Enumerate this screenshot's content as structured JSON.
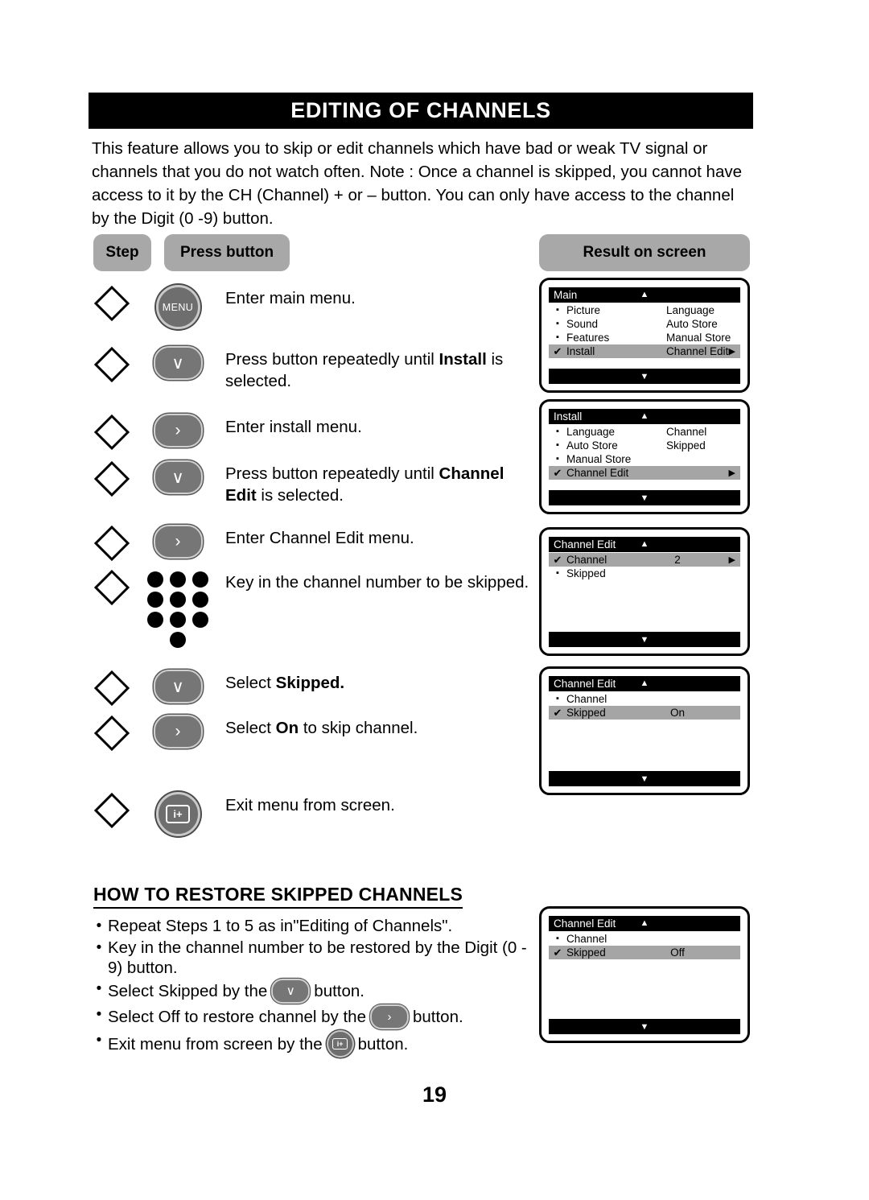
{
  "page": {
    "title": "EDITING OF CHANNELS",
    "intro": "This feature allows you to skip or edit channels which have bad or weak TV signal or channels that you do not watch often. Note : Once a channel is skipped, you cannot have access to it by the CH (Channel) + or – button. You can only have access to the channel by the Digit (0 -9) button.",
    "page_number": "19"
  },
  "table_headers": {
    "step": "Step",
    "press_button": "Press button",
    "result_on_screen": "Result on screen"
  },
  "steps": [
    {
      "button": "MENU",
      "button_type": "round-text",
      "text_parts": [
        {
          "t": "Enter main menu.",
          "bold": false
        }
      ]
    },
    {
      "button": "∨",
      "button_type": "oval",
      "text_parts": [
        {
          "t": "Press button repeatedly until ",
          "bold": false
        },
        {
          "t": "Install",
          "bold": true
        },
        {
          "t": " is selected.",
          "bold": false
        }
      ]
    },
    {
      "button": "›",
      "button_type": "oval",
      "text_parts": [
        {
          "t": "Enter install menu.",
          "bold": false
        }
      ]
    },
    {
      "button": "∨",
      "button_type": "oval",
      "text_parts": [
        {
          "t": "Press button repeatedly until ",
          "bold": false
        },
        {
          "t": "Channel Edit",
          "bold": true
        },
        {
          "t": " is selected.",
          "bold": false
        }
      ]
    },
    {
      "button": "›",
      "button_type": "oval",
      "text_parts": [
        {
          "t": "Enter Channel Edit menu.",
          "bold": false
        }
      ]
    },
    {
      "button": "keypad",
      "button_type": "keypad",
      "text_parts": [
        {
          "t": "Key in the channel number to be skipped.",
          "bold": false
        }
      ]
    },
    {
      "button": "∨",
      "button_type": "oval",
      "text_parts": [
        {
          "t": "Select ",
          "bold": false
        },
        {
          "t": "Skipped.",
          "bold": true
        }
      ]
    },
    {
      "button": "›",
      "button_type": "oval",
      "text_parts": [
        {
          "t": "Select ",
          "bold": false
        },
        {
          "t": "On",
          "bold": true
        },
        {
          "t": " to skip channel.",
          "bold": false
        }
      ]
    },
    {
      "button": "i+",
      "button_type": "round-info",
      "text_parts": [
        {
          "t": "Exit menu from screen.",
          "bold": false
        }
      ]
    }
  ],
  "screens": [
    {
      "title": "Main",
      "up_arrow": "▲",
      "down_arrow": "▼",
      "rows": [
        {
          "mark": "▪",
          "name": "Picture",
          "val": "",
          "arrow": "",
          "right": "Language",
          "selected": false
        },
        {
          "mark": "▪",
          "name": "Sound",
          "val": "",
          "arrow": "",
          "right": "Auto Store",
          "selected": false
        },
        {
          "mark": "▪",
          "name": "Features",
          "val": "",
          "arrow": "",
          "right": "Manual Store",
          "selected": false
        },
        {
          "mark": "✔",
          "name": "Install",
          "val": "",
          "arrow": "▶",
          "right": "Channel Edit",
          "selected": true
        }
      ]
    },
    {
      "title": "Install",
      "up_arrow": "▲",
      "down_arrow": "▼",
      "rows": [
        {
          "mark": "▪",
          "name": "Language",
          "val": "",
          "arrow": "",
          "right": "Channel",
          "selected": false
        },
        {
          "mark": "▪",
          "name": "Auto Store",
          "val": "",
          "arrow": "",
          "right": "Skipped",
          "selected": false
        },
        {
          "mark": "▪",
          "name": "Manual Store",
          "val": "",
          "arrow": "",
          "right": "",
          "selected": false
        },
        {
          "mark": "✔",
          "name": "Channel Edit",
          "val": "",
          "arrow": "▶",
          "right": "",
          "selected": true
        }
      ]
    },
    {
      "title": "Channel Edit",
      "up_arrow": "▲",
      "down_arrow": "▼",
      "rows": [
        {
          "mark": "✔",
          "name": "Channel",
          "val": "2",
          "arrow": "▶",
          "right": "",
          "selected": true
        },
        {
          "mark": "▪",
          "name": "Skipped",
          "val": "",
          "arrow": "",
          "right": "",
          "selected": false
        }
      ]
    },
    {
      "title": "Channel Edit",
      "up_arrow": "▲",
      "down_arrow": "▼",
      "rows": [
        {
          "mark": "▪",
          "name": "Channel",
          "val": "",
          "arrow": "",
          "right": "",
          "selected": false
        },
        {
          "mark": "✔",
          "name": "Skipped",
          "val": "On",
          "arrow": "",
          "right": "",
          "selected": true
        }
      ]
    },
    {
      "title": "Channel Edit",
      "up_arrow": "▲",
      "down_arrow": "▼",
      "rows": [
        {
          "mark": "▪",
          "name": "Channel",
          "val": "",
          "arrow": "",
          "right": "",
          "selected": false
        },
        {
          "mark": "✔",
          "name": "Skipped",
          "val": "Off",
          "arrow": "",
          "right": "",
          "selected": true
        }
      ]
    }
  ],
  "restore": {
    "heading": "HOW TO RESTORE SKIPPED CHANNELS",
    "bullet": "•",
    "items": [
      {
        "parts": [
          {
            "t": "Repeat Steps 1 to 5 as in\"Editing of Channels\"."
          }
        ]
      },
      {
        "parts": [
          {
            "t": "Key in the channel number to be restored by the Digit (0 - 9) button."
          }
        ]
      },
      {
        "parts": [
          {
            "t": "Select Skipped by the"
          },
          {
            "btn": "oval",
            "glyph": "∨"
          },
          {
            "t": "button."
          }
        ]
      },
      {
        "parts": [
          {
            "t": "Select Off to restore channel by the"
          },
          {
            "btn": "oval",
            "glyph": "›"
          },
          {
            "t": "button."
          }
        ]
      },
      {
        "parts": [
          {
            "t": "Exit menu from screen by the"
          },
          {
            "btn": "info",
            "glyph": "i+"
          },
          {
            "t": "button."
          }
        ]
      }
    ]
  }
}
